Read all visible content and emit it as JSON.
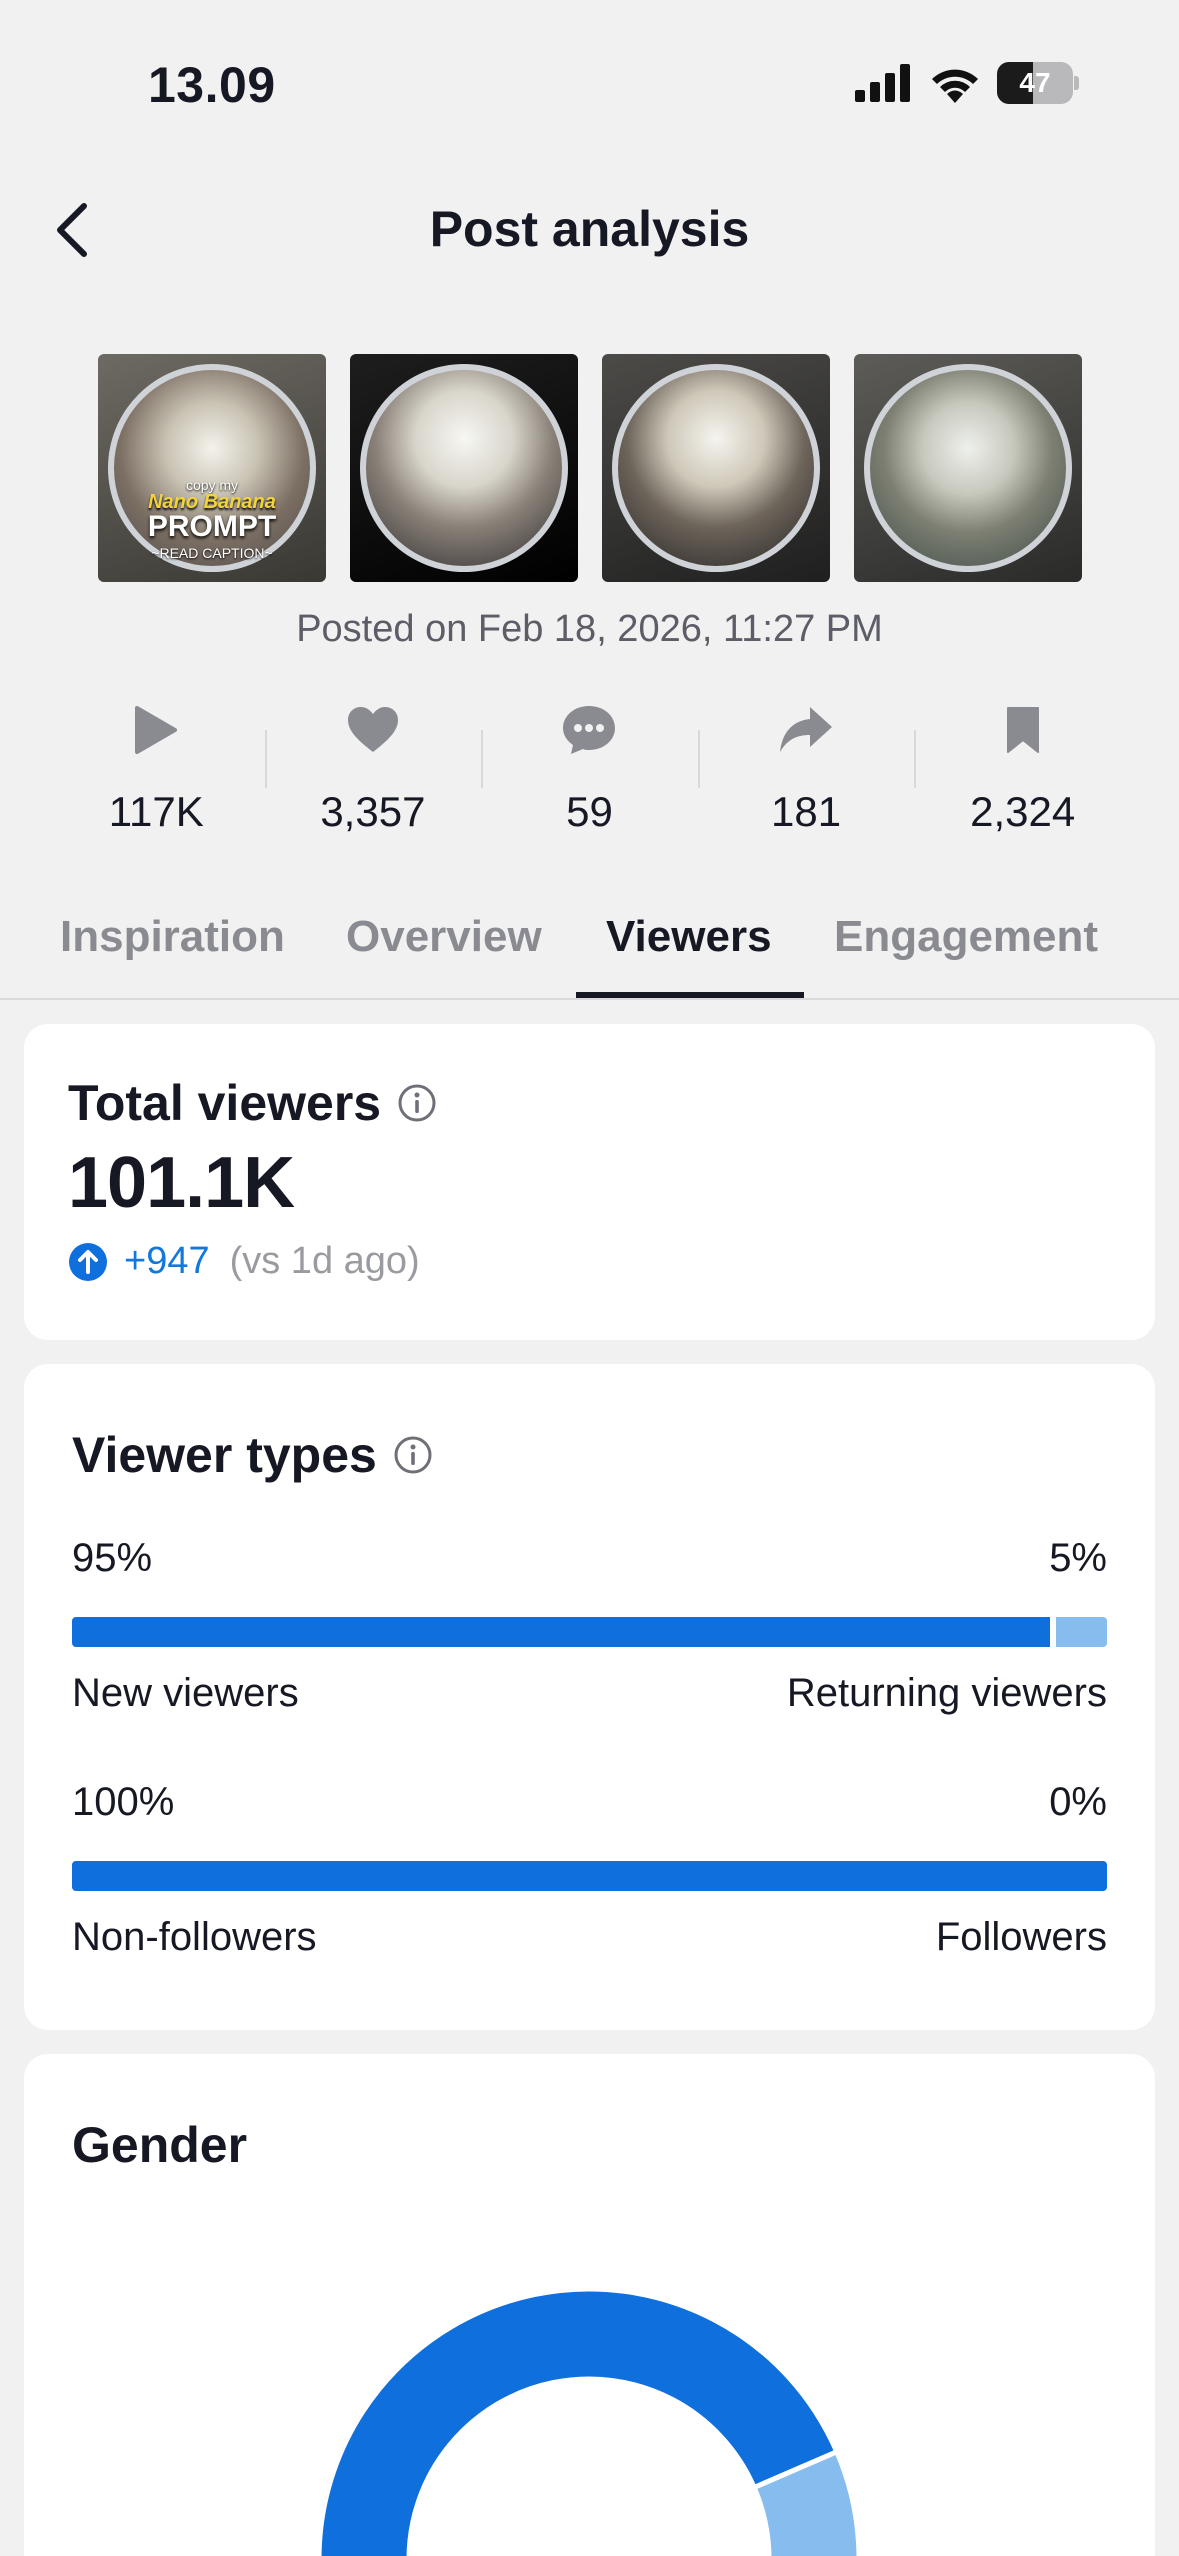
{
  "status_bar": {
    "time": "13.09",
    "battery": "47",
    "battery_level": 0.47
  },
  "header": {
    "title": "Post analysis"
  },
  "thumbnails": [
    {
      "caption_small": "copy my",
      "caption_tag": "Nano Banana",
      "caption_big": "PROMPT",
      "caption_sub": "~READ CAPTION~"
    },
    {
      "caption_small": "",
      "caption_tag": "",
      "caption_big": "",
      "caption_sub": ""
    },
    {
      "caption_small": "",
      "caption_tag": "",
      "caption_big": "",
      "caption_sub": ""
    },
    {
      "caption_small": "",
      "caption_tag": "",
      "caption_big": "",
      "caption_sub": ""
    }
  ],
  "posted": "Posted on Feb 18, 2026, 11:27 PM",
  "stats": [
    {
      "icon": "play-icon",
      "value": "117K"
    },
    {
      "icon": "heart-icon",
      "value": "3,357"
    },
    {
      "icon": "comment-icon",
      "value": "59"
    },
    {
      "icon": "share-icon",
      "value": "181"
    },
    {
      "icon": "bookmark-icon",
      "value": "2,324"
    }
  ],
  "tabs": [
    {
      "label": "Inspiration",
      "active": false
    },
    {
      "label": "Overview",
      "active": false
    },
    {
      "label": "Viewers",
      "active": true
    },
    {
      "label": "Engagement",
      "active": false
    }
  ],
  "total_viewers": {
    "title": "Total viewers",
    "value": "101.1K",
    "delta": "+947",
    "comparison": "(vs 1d ago)"
  },
  "viewer_types": {
    "title": "Viewer types",
    "rows": [
      {
        "left_pct": "95%",
        "right_pct": "5%",
        "left_fraction": 0.95,
        "left_label": "New viewers",
        "right_label": "Returning viewers"
      },
      {
        "left_pct": "100%",
        "right_pct": "0%",
        "left_fraction": 1.0,
        "left_label": "Non-followers",
        "right_label": "Followers"
      }
    ]
  },
  "gender": {
    "title": "Gender",
    "segments": [
      {
        "fraction": 0.87,
        "color": "#0f6fdc"
      },
      {
        "fraction": 0.13,
        "color": "#86bcee"
      }
    ]
  },
  "colors": {
    "accent": "#0f6fdc",
    "accent_light": "#86bcee",
    "text": "#161823",
    "muted": "#8a8b91"
  }
}
